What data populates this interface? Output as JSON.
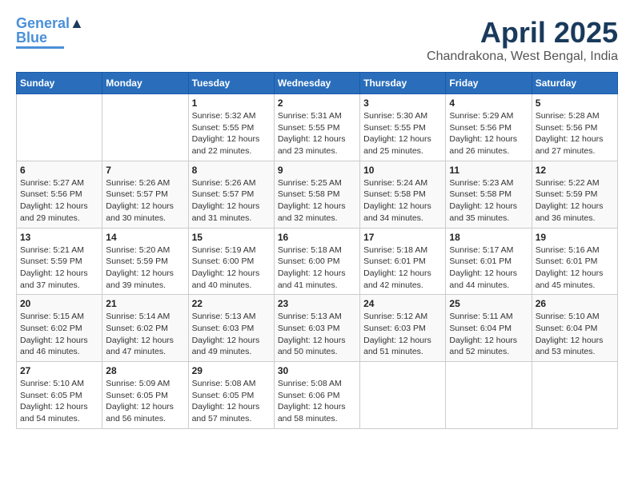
{
  "header": {
    "logo_line1": "General",
    "logo_line2": "Blue",
    "month": "April 2025",
    "location": "Chandrakona, West Bengal, India"
  },
  "weekdays": [
    "Sunday",
    "Monday",
    "Tuesday",
    "Wednesday",
    "Thursday",
    "Friday",
    "Saturday"
  ],
  "weeks": [
    [
      {
        "day": "",
        "sunrise": "",
        "sunset": "",
        "daylight": ""
      },
      {
        "day": "",
        "sunrise": "",
        "sunset": "",
        "daylight": ""
      },
      {
        "day": "1",
        "sunrise": "Sunrise: 5:32 AM",
        "sunset": "Sunset: 5:55 PM",
        "daylight": "Daylight: 12 hours and 22 minutes."
      },
      {
        "day": "2",
        "sunrise": "Sunrise: 5:31 AM",
        "sunset": "Sunset: 5:55 PM",
        "daylight": "Daylight: 12 hours and 23 minutes."
      },
      {
        "day": "3",
        "sunrise": "Sunrise: 5:30 AM",
        "sunset": "Sunset: 5:55 PM",
        "daylight": "Daylight: 12 hours and 25 minutes."
      },
      {
        "day": "4",
        "sunrise": "Sunrise: 5:29 AM",
        "sunset": "Sunset: 5:56 PM",
        "daylight": "Daylight: 12 hours and 26 minutes."
      },
      {
        "day": "5",
        "sunrise": "Sunrise: 5:28 AM",
        "sunset": "Sunset: 5:56 PM",
        "daylight": "Daylight: 12 hours and 27 minutes."
      }
    ],
    [
      {
        "day": "6",
        "sunrise": "Sunrise: 5:27 AM",
        "sunset": "Sunset: 5:56 PM",
        "daylight": "Daylight: 12 hours and 29 minutes."
      },
      {
        "day": "7",
        "sunrise": "Sunrise: 5:26 AM",
        "sunset": "Sunset: 5:57 PM",
        "daylight": "Daylight: 12 hours and 30 minutes."
      },
      {
        "day": "8",
        "sunrise": "Sunrise: 5:26 AM",
        "sunset": "Sunset: 5:57 PM",
        "daylight": "Daylight: 12 hours and 31 minutes."
      },
      {
        "day": "9",
        "sunrise": "Sunrise: 5:25 AM",
        "sunset": "Sunset: 5:58 PM",
        "daylight": "Daylight: 12 hours and 32 minutes."
      },
      {
        "day": "10",
        "sunrise": "Sunrise: 5:24 AM",
        "sunset": "Sunset: 5:58 PM",
        "daylight": "Daylight: 12 hours and 34 minutes."
      },
      {
        "day": "11",
        "sunrise": "Sunrise: 5:23 AM",
        "sunset": "Sunset: 5:58 PM",
        "daylight": "Daylight: 12 hours and 35 minutes."
      },
      {
        "day": "12",
        "sunrise": "Sunrise: 5:22 AM",
        "sunset": "Sunset: 5:59 PM",
        "daylight": "Daylight: 12 hours and 36 minutes."
      }
    ],
    [
      {
        "day": "13",
        "sunrise": "Sunrise: 5:21 AM",
        "sunset": "Sunset: 5:59 PM",
        "daylight": "Daylight: 12 hours and 37 minutes."
      },
      {
        "day": "14",
        "sunrise": "Sunrise: 5:20 AM",
        "sunset": "Sunset: 5:59 PM",
        "daylight": "Daylight: 12 hours and 39 minutes."
      },
      {
        "day": "15",
        "sunrise": "Sunrise: 5:19 AM",
        "sunset": "Sunset: 6:00 PM",
        "daylight": "Daylight: 12 hours and 40 minutes."
      },
      {
        "day": "16",
        "sunrise": "Sunrise: 5:18 AM",
        "sunset": "Sunset: 6:00 PM",
        "daylight": "Daylight: 12 hours and 41 minutes."
      },
      {
        "day": "17",
        "sunrise": "Sunrise: 5:18 AM",
        "sunset": "Sunset: 6:01 PM",
        "daylight": "Daylight: 12 hours and 42 minutes."
      },
      {
        "day": "18",
        "sunrise": "Sunrise: 5:17 AM",
        "sunset": "Sunset: 6:01 PM",
        "daylight": "Daylight: 12 hours and 44 minutes."
      },
      {
        "day": "19",
        "sunrise": "Sunrise: 5:16 AM",
        "sunset": "Sunset: 6:01 PM",
        "daylight": "Daylight: 12 hours and 45 minutes."
      }
    ],
    [
      {
        "day": "20",
        "sunrise": "Sunrise: 5:15 AM",
        "sunset": "Sunset: 6:02 PM",
        "daylight": "Daylight: 12 hours and 46 minutes."
      },
      {
        "day": "21",
        "sunrise": "Sunrise: 5:14 AM",
        "sunset": "Sunset: 6:02 PM",
        "daylight": "Daylight: 12 hours and 47 minutes."
      },
      {
        "day": "22",
        "sunrise": "Sunrise: 5:13 AM",
        "sunset": "Sunset: 6:03 PM",
        "daylight": "Daylight: 12 hours and 49 minutes."
      },
      {
        "day": "23",
        "sunrise": "Sunrise: 5:13 AM",
        "sunset": "Sunset: 6:03 PM",
        "daylight": "Daylight: 12 hours and 50 minutes."
      },
      {
        "day": "24",
        "sunrise": "Sunrise: 5:12 AM",
        "sunset": "Sunset: 6:03 PM",
        "daylight": "Daylight: 12 hours and 51 minutes."
      },
      {
        "day": "25",
        "sunrise": "Sunrise: 5:11 AM",
        "sunset": "Sunset: 6:04 PM",
        "daylight": "Daylight: 12 hours and 52 minutes."
      },
      {
        "day": "26",
        "sunrise": "Sunrise: 5:10 AM",
        "sunset": "Sunset: 6:04 PM",
        "daylight": "Daylight: 12 hours and 53 minutes."
      }
    ],
    [
      {
        "day": "27",
        "sunrise": "Sunrise: 5:10 AM",
        "sunset": "Sunset: 6:05 PM",
        "daylight": "Daylight: 12 hours and 54 minutes."
      },
      {
        "day": "28",
        "sunrise": "Sunrise: 5:09 AM",
        "sunset": "Sunset: 6:05 PM",
        "daylight": "Daylight: 12 hours and 56 minutes."
      },
      {
        "day": "29",
        "sunrise": "Sunrise: 5:08 AM",
        "sunset": "Sunset: 6:05 PM",
        "daylight": "Daylight: 12 hours and 57 minutes."
      },
      {
        "day": "30",
        "sunrise": "Sunrise: 5:08 AM",
        "sunset": "Sunset: 6:06 PM",
        "daylight": "Daylight: 12 hours and 58 minutes."
      },
      {
        "day": "",
        "sunrise": "",
        "sunset": "",
        "daylight": ""
      },
      {
        "day": "",
        "sunrise": "",
        "sunset": "",
        "daylight": ""
      },
      {
        "day": "",
        "sunrise": "",
        "sunset": "",
        "daylight": ""
      }
    ]
  ]
}
